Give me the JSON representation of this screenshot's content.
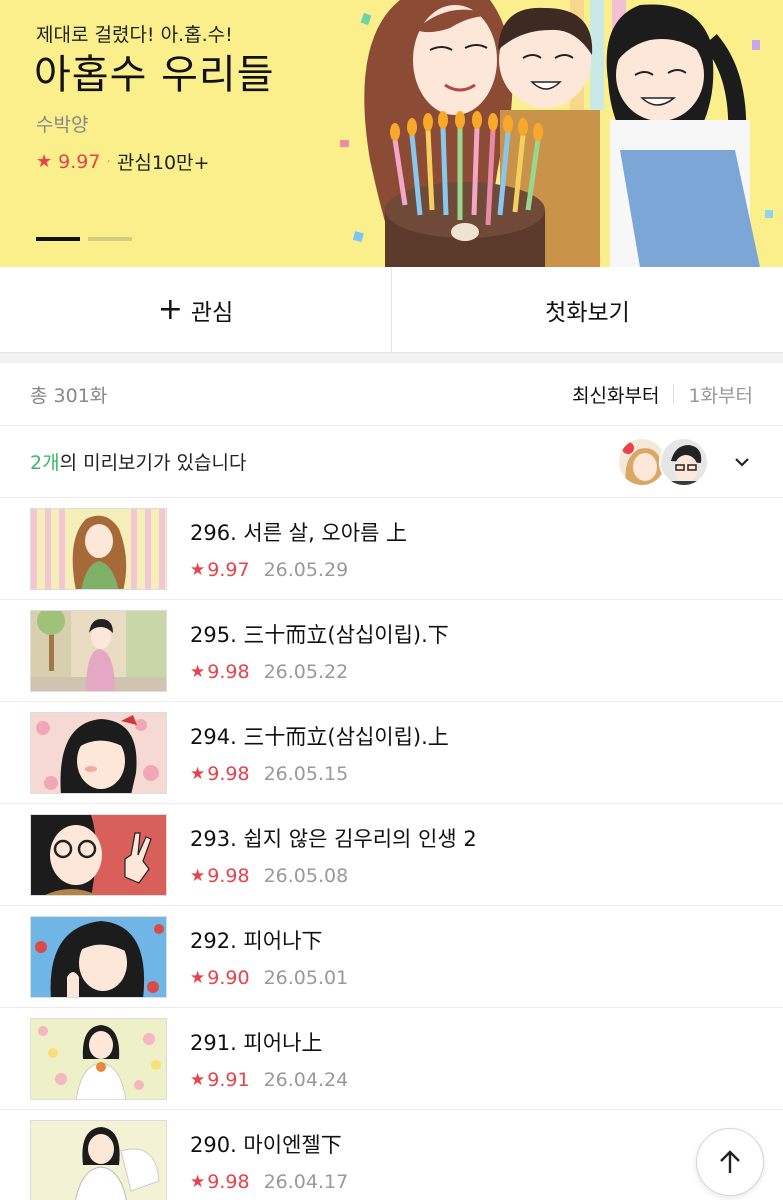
{
  "banner": {
    "tagline": "제대로 걸렸다! 아.홉.수!",
    "title": "아홉수 우리들",
    "author": "수박양",
    "rating": "9.97",
    "interest": "관심10만+",
    "bg_color": "#fbef8c"
  },
  "actions": {
    "interest_label": "관심",
    "first_episode_label": "첫화보기"
  },
  "list_head": {
    "total": "총 301화",
    "sort_latest": "최신화부터",
    "sort_first": "1화부터"
  },
  "preview": {
    "count": "2개",
    "text": "의 미리보기가 있습니다"
  },
  "episodes": [
    {
      "title": "296. 서른 살, 오아름 上",
      "rating": "9.97",
      "date": "26.05.29"
    },
    {
      "title": "295. 三十而立(삼십이립).下",
      "rating": "9.98",
      "date": "26.05.22"
    },
    {
      "title": "294. 三十而立(삼십이립).上",
      "rating": "9.98",
      "date": "26.05.15"
    },
    {
      "title": "293. 쉽지 않은 김우리의 인생 2",
      "rating": "9.98",
      "date": "26.05.08"
    },
    {
      "title": "292. 피어나下",
      "rating": "9.90",
      "date": "26.05.01"
    },
    {
      "title": "291. 피어나上",
      "rating": "9.91",
      "date": "26.04.24"
    },
    {
      "title": "290. 마이엔젤下",
      "rating": "9.98",
      "date": "26.04.17"
    }
  ],
  "colors": {
    "accent_red": "#e8424a",
    "accent_green": "#38b76a"
  }
}
